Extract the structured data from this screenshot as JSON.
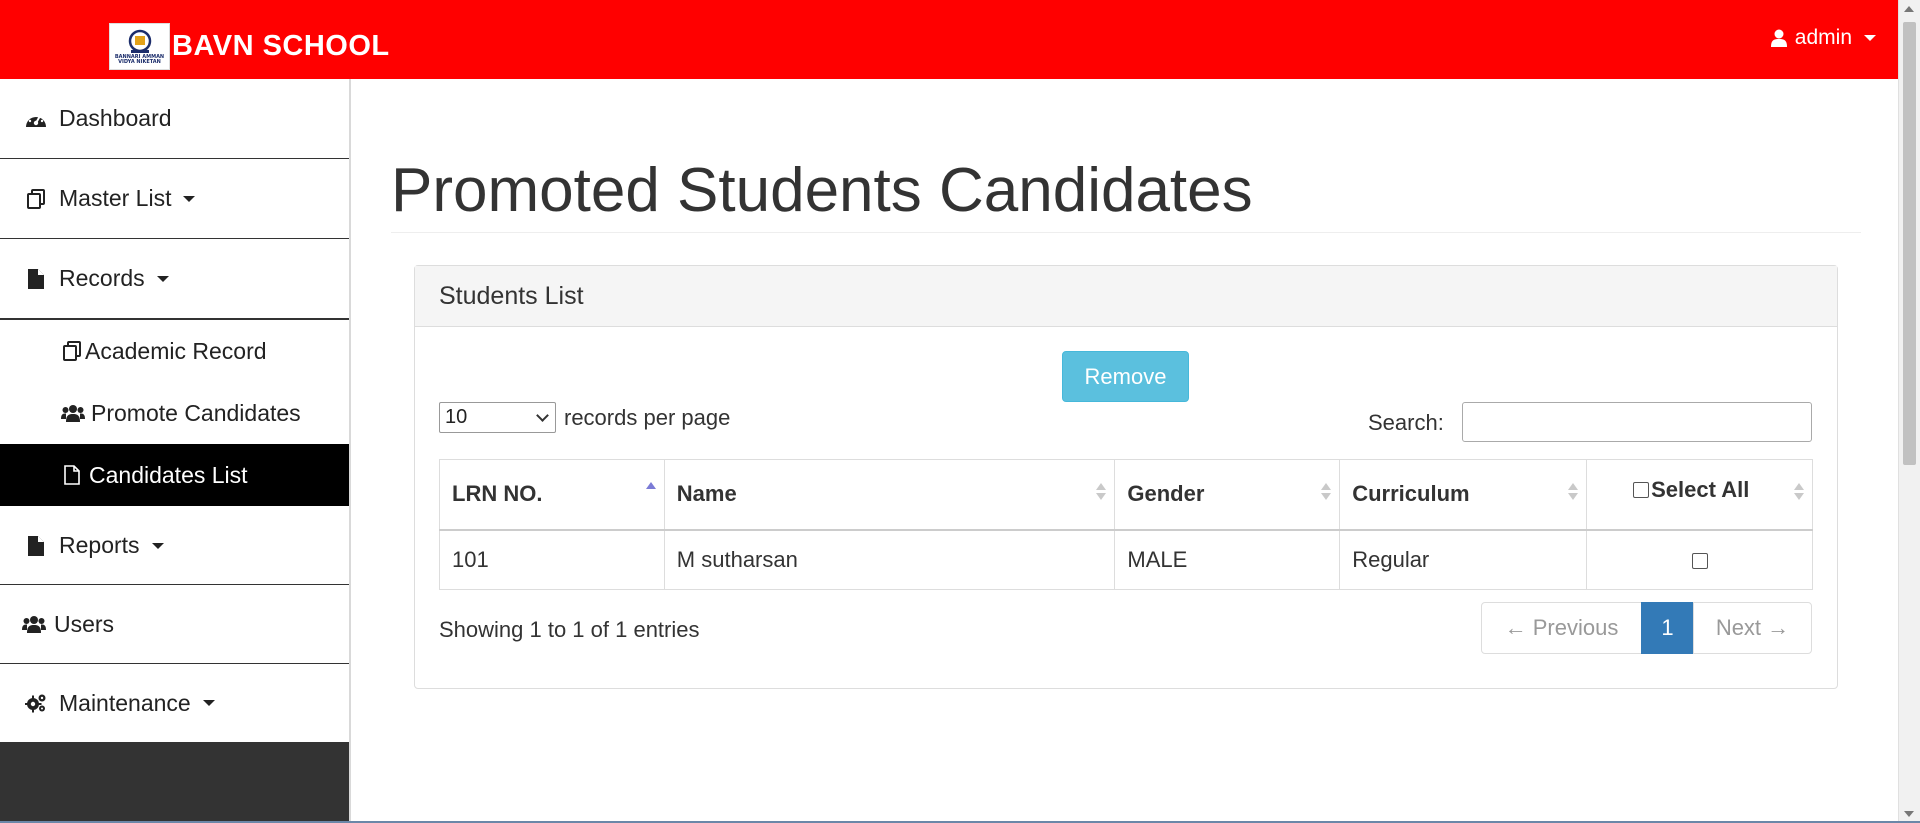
{
  "brand": {
    "name": "BAVN SCHOOL",
    "logo_text": "BANNARI AMMAN VIDYA NIKETAN"
  },
  "user": {
    "name": "admin"
  },
  "sidebar": {
    "items": [
      {
        "label": "Dashboard",
        "icon": "dashboard-icon"
      },
      {
        "label": "Master List",
        "icon": "copy-icon",
        "dropdown": true
      },
      {
        "label": "Records",
        "icon": "file-icon",
        "dropdown": true
      },
      {
        "label": "Academic Record",
        "icon": "copy-icon",
        "sub": true
      },
      {
        "label": "Promote Candidates",
        "icon": "users-icon",
        "sub": true
      },
      {
        "label": "Candidates List",
        "icon": "file-outline-icon",
        "sub": true,
        "active": true
      },
      {
        "label": "Reports",
        "icon": "file-icon",
        "dropdown": true
      },
      {
        "label": "Users",
        "icon": "users-icon"
      },
      {
        "label": "Maintenance",
        "icon": "cogs-icon",
        "dropdown": true
      }
    ]
  },
  "page": {
    "title": "Promoted Students Candidates"
  },
  "panel": {
    "title": "Students List",
    "remove_label": "Remove",
    "length": {
      "value": "10",
      "label": "records per page"
    },
    "search": {
      "label": "Search:",
      "value": ""
    },
    "columns": [
      "LRN NO.",
      "Name",
      "Gender",
      "Curriculum",
      "Select All"
    ],
    "rows": [
      {
        "lrn": "101",
        "name": "M sutharsan",
        "gender": "MALE",
        "curriculum": "Regular",
        "selected": false
      }
    ],
    "info": "Showing 1 to 1 of 1 entries",
    "pagination": {
      "prev": "← Previous",
      "current": "1",
      "next": "Next →"
    }
  },
  "colors": {
    "topbar": "#ff0000",
    "active_nav": "#000000",
    "remove_button": "#5bc0de",
    "current_page": "#337ab7"
  }
}
